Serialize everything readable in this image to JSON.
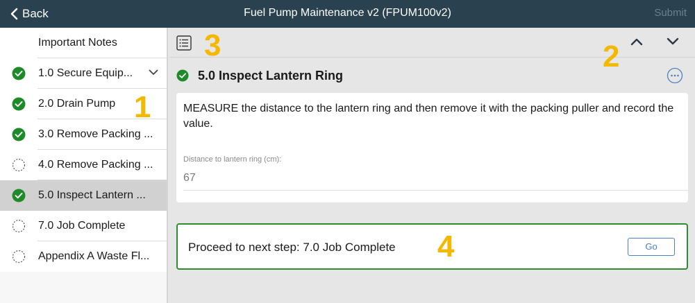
{
  "header": {
    "back_label": "Back",
    "title": "Fuel Pump Maintenance v2 (FPUM100v2)",
    "submit_label": "Submit"
  },
  "sidebar": {
    "items": [
      {
        "label": "Important Notes",
        "status": "none"
      },
      {
        "label": "1.0 Secure Equip...",
        "status": "complete",
        "expandable": true
      },
      {
        "label": "2.0 Drain Pump",
        "status": "complete"
      },
      {
        "label": "3.0 Remove Packing ...",
        "status": "complete"
      },
      {
        "label": "4.0 Remove Packing ...",
        "status": "incomplete"
      },
      {
        "label": "5.0 Inspect Lantern ...",
        "status": "complete",
        "selected": true
      },
      {
        "label": "7.0 Job Complete",
        "status": "incomplete"
      },
      {
        "label": "Appendix A Waste Fl...",
        "status": "incomplete"
      }
    ]
  },
  "step": {
    "title": "5.0 Inspect Lantern Ring",
    "instruction": "MEASURE the distance to the lantern ring and then remove it with the packing puller and record the value.",
    "field_label": "Distance to lantern ring (cm):",
    "field_value": "67"
  },
  "proceed": {
    "text": "Proceed to next step: 7.0 Job Complete",
    "go_label": "Go"
  },
  "annotations": {
    "a1": "1",
    "a2": "2",
    "a3": "3",
    "a4": "4"
  },
  "icons": {
    "back": "chevron-left-icon",
    "list": "list-icon",
    "up": "chevron-up-icon",
    "down": "chevron-down-icon",
    "more": "more-icon",
    "complete": "check-circle-icon",
    "incomplete": "dashed-circle-icon"
  },
  "colors": {
    "header_bg": "#2a4150",
    "complete_green": "#1e8a2a",
    "proceed_border": "#2e8b2e",
    "accent_blue": "#4a7fc1",
    "annotation_yellow": "#f5b800"
  }
}
